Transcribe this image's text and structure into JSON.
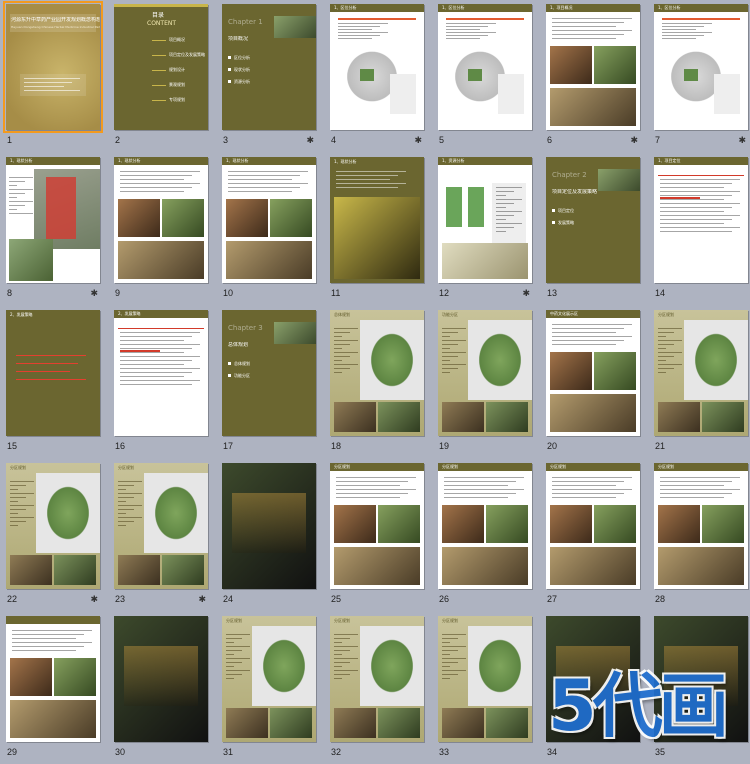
{
  "colors": {
    "olive": "#6b6630",
    "olive_dark": "#4e4a1f",
    "olive_light": "#b5b077",
    "gold": "#c8b54a",
    "photo_dark": "#2b2a16",
    "map_green": "#5f8a46",
    "selection": "#f39a1e"
  },
  "slides": [
    {
      "n": "1",
      "star": "",
      "kind": "cover",
      "title": "河源东升中草药产业园开发规划概念构想",
      "subtitle": "Heyuan Dongsheng Chinese Herbal Medicine Industrial Park Planning Concept"
    },
    {
      "n": "2",
      "star": "",
      "kind": "contents",
      "title": "目录",
      "title2": "CONTENT",
      "items": [
        "项目概况",
        "项目定位及发展策略",
        "规划设计",
        "景观规划",
        "专项规划"
      ]
    },
    {
      "n": "3",
      "star": "✱",
      "kind": "chapter",
      "chapter": "Chapter 1",
      "title": "项目概况",
      "items": [
        "区位分析",
        "现状分析",
        "资源分析"
      ]
    },
    {
      "n": "4",
      "star": "✱",
      "kind": "map",
      "title": "1、区位分析"
    },
    {
      "n": "5",
      "star": "",
      "kind": "map",
      "title": "1、区位分析"
    },
    {
      "n": "6",
      "star": "✱",
      "kind": "photo",
      "title": "1、项目概况"
    },
    {
      "n": "7",
      "star": "✱",
      "kind": "map",
      "title": "1、区位分析"
    },
    {
      "n": "8",
      "star": "✱",
      "kind": "terrain",
      "title": "1、现状分析"
    },
    {
      "n": "9",
      "star": "",
      "kind": "photo",
      "title": "1、现状分析"
    },
    {
      "n": "10",
      "star": "",
      "kind": "photo",
      "title": "1、现状分析"
    },
    {
      "n": "11",
      "star": "",
      "kind": "olivephoto",
      "title": "1、现状分析"
    },
    {
      "n": "12",
      "star": "✱",
      "kind": "diagram",
      "title": "1、资源分析"
    },
    {
      "n": "13",
      "star": "",
      "kind": "chapter",
      "chapter": "Chapter 2",
      "title": "项目定位及发展策略",
      "items": [
        "项目定位",
        "发展策略"
      ]
    },
    {
      "n": "14",
      "star": "",
      "kind": "textslide",
      "title": "1、项目定位"
    },
    {
      "n": "15",
      "star": "",
      "kind": "olivetext",
      "title": "2、发展策略"
    },
    {
      "n": "16",
      "star": "",
      "kind": "textslide",
      "title": "2、发展策略"
    },
    {
      "n": "17",
      "star": "",
      "kind": "chapter",
      "chapter": "Chapter 3",
      "title": "总体规划",
      "items": [
        "总体规划",
        "功能分区"
      ]
    },
    {
      "n": "18",
      "star": "",
      "kind": "planmap",
      "title": "总体规划"
    },
    {
      "n": "19",
      "star": "",
      "kind": "planmap",
      "title": "功能分区"
    },
    {
      "n": "20",
      "star": "",
      "kind": "photo",
      "title": "中药文化展示区"
    },
    {
      "n": "21",
      "star": "",
      "kind": "planmap",
      "title": "分区规划"
    },
    {
      "n": "22",
      "star": "✱",
      "kind": "planmap",
      "title": "分区规划"
    },
    {
      "n": "23",
      "star": "✱",
      "kind": "planmap",
      "title": "分区规划"
    },
    {
      "n": "24",
      "star": "",
      "kind": "darkphoto",
      "title": ""
    },
    {
      "n": "25",
      "star": "",
      "kind": "photo",
      "title": "分区规划"
    },
    {
      "n": "26",
      "star": "",
      "kind": "photo",
      "title": "分区规划"
    },
    {
      "n": "27",
      "star": "",
      "kind": "photo",
      "title": "分区规划"
    },
    {
      "n": "28",
      "star": "",
      "kind": "photo",
      "title": "分区规划"
    },
    {
      "n": "29",
      "star": "",
      "kind": "photo",
      "title": ""
    },
    {
      "n": "30",
      "star": "",
      "kind": "darkphoto",
      "title": ""
    },
    {
      "n": "31",
      "star": "",
      "kind": "planmap",
      "title": "分区规划"
    },
    {
      "n": "32",
      "star": "",
      "kind": "planmap",
      "title": "分区规划"
    },
    {
      "n": "33",
      "star": "",
      "kind": "planmap",
      "title": "分区规划"
    },
    {
      "n": "34",
      "star": "",
      "kind": "darkphoto",
      "title": ""
    },
    {
      "n": "35",
      "star": "",
      "kind": "darkphoto",
      "title": ""
    }
  ],
  "watermark": "5代画"
}
